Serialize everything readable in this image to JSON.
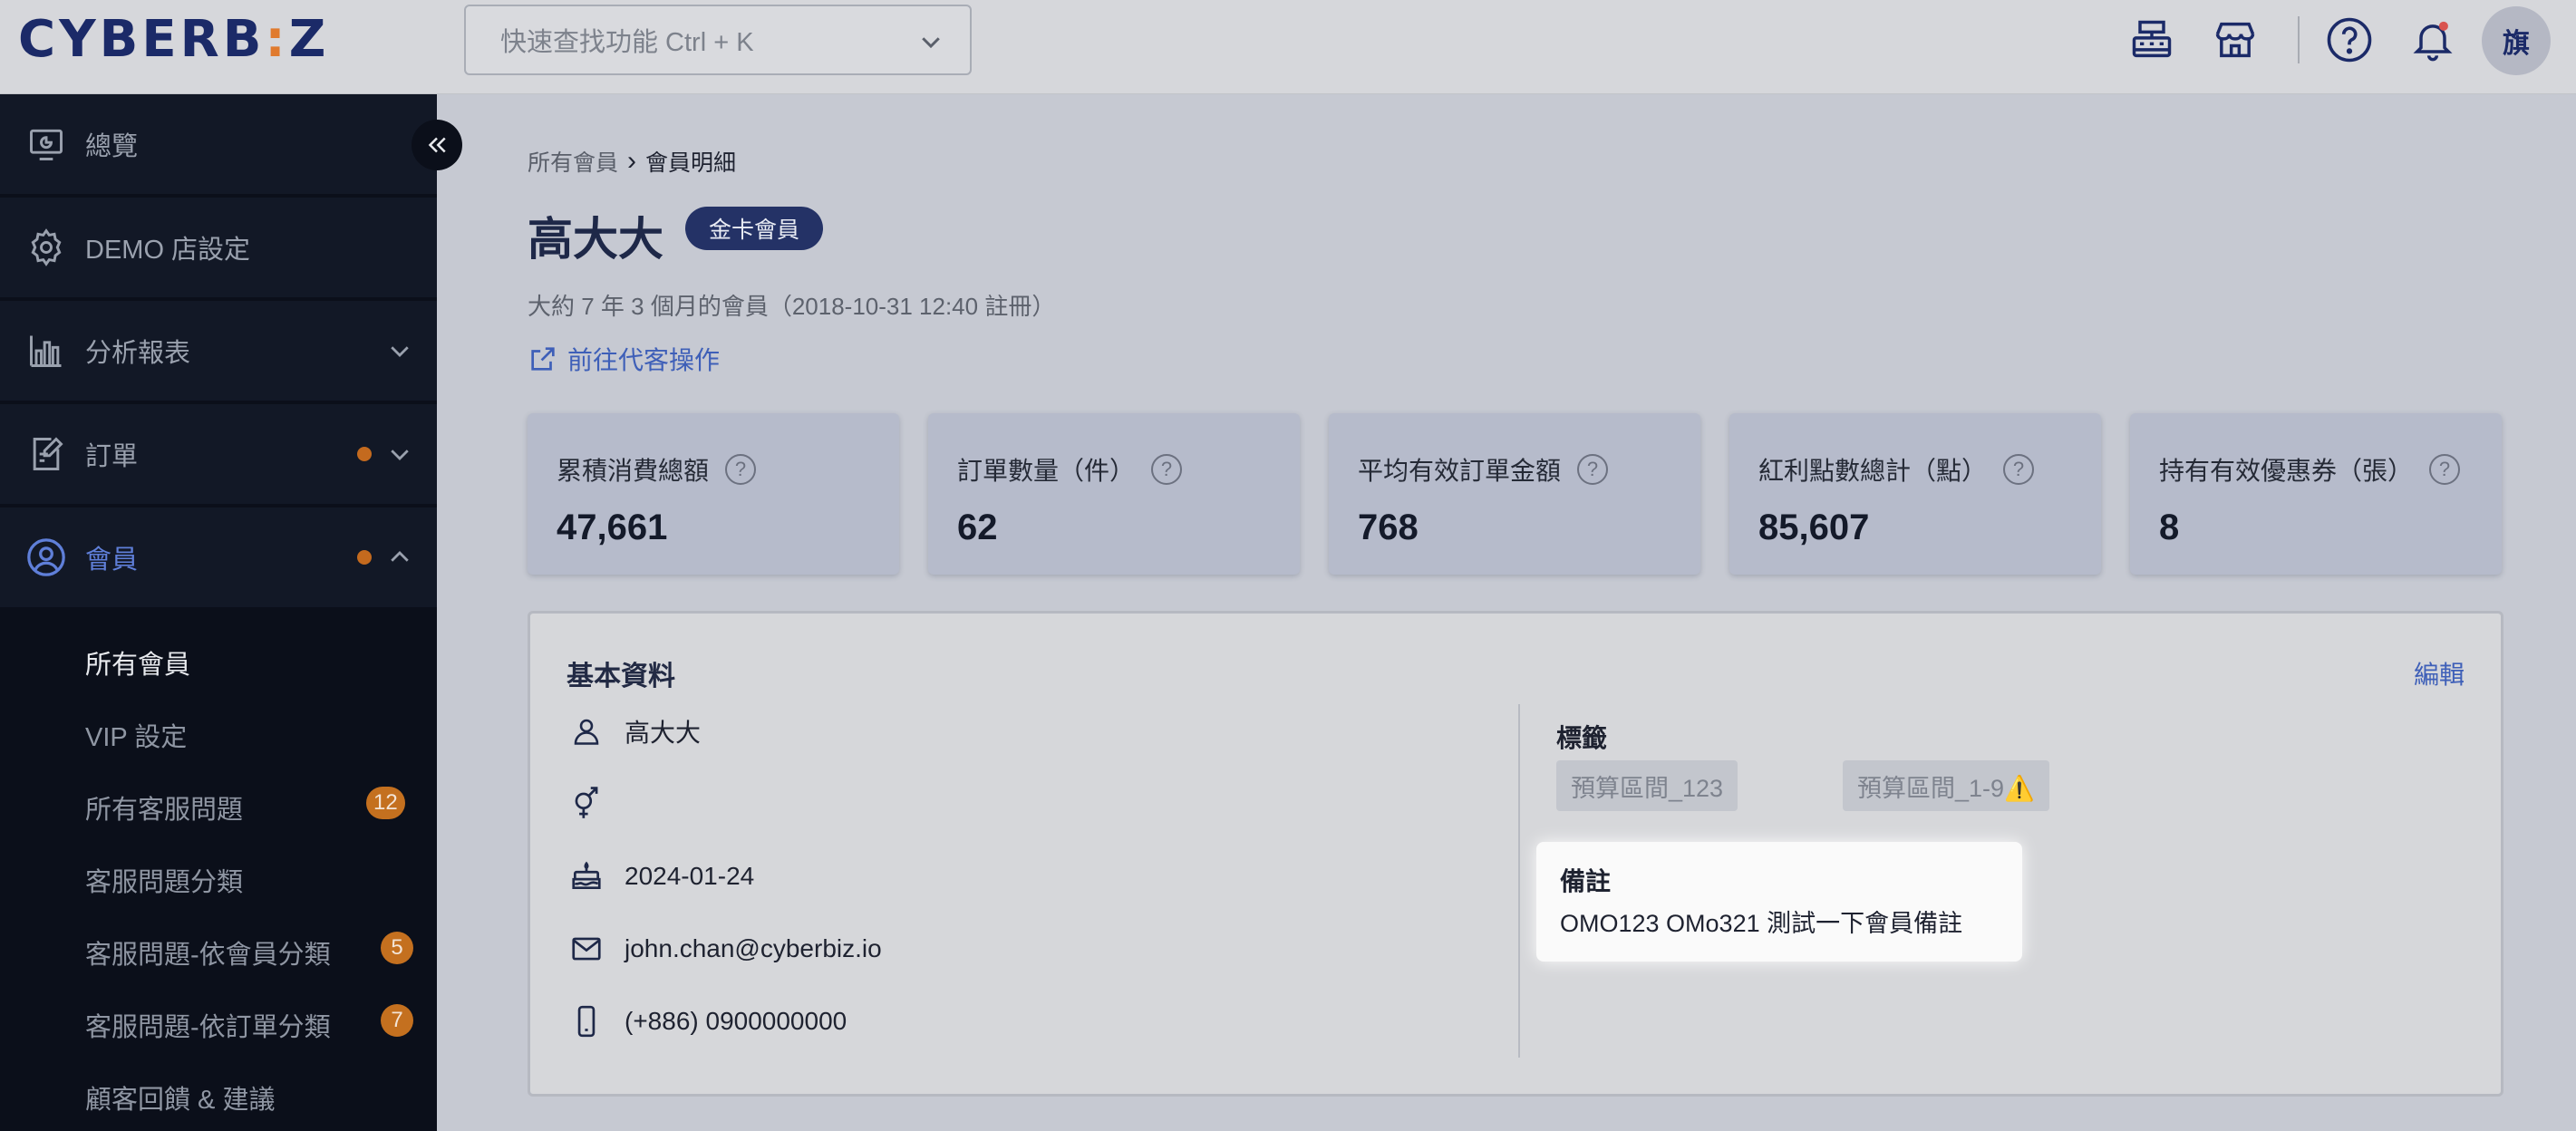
{
  "header": {
    "logo_left": "CYBERB",
    "logo_dot": ":",
    "logo_right": "Z",
    "search_placeholder": "快速查找功能 Ctrl + K",
    "avatar_label": "旗"
  },
  "sidebar": {
    "items": [
      {
        "label": "總覽"
      },
      {
        "label": "DEMO 店設定"
      },
      {
        "label": "分析報表"
      },
      {
        "label": "訂單"
      },
      {
        "label": "會員"
      }
    ],
    "sub_items": [
      {
        "label": "所有會員"
      },
      {
        "label": "VIP 設定"
      },
      {
        "label": "所有客服問題",
        "badge": "12"
      },
      {
        "label": "客服問題分類"
      },
      {
        "label": "客服問題-依會員分類",
        "badge": "5"
      },
      {
        "label": "客服問題-依訂單分類",
        "badge": "7"
      },
      {
        "label": "顧客回饋 & 建議"
      }
    ]
  },
  "main": {
    "breadcrumb": {
      "parent": "所有會員",
      "sep": "›",
      "current": "會員明細"
    },
    "member_name": "高大大",
    "tier_badge": "金卡會員",
    "member_since": "大約 7 年 3 個月的會員（2018-10-31 12:40 註冊）",
    "proxy_link": "前往代客操作",
    "stats": [
      {
        "label": "累積消費總額",
        "value": "47,661"
      },
      {
        "label": "訂單數量（件）",
        "value": "62"
      },
      {
        "label": "平均有效訂單金額",
        "value": "768"
      },
      {
        "label": "紅利點數總計（點）",
        "value": "85,607"
      },
      {
        "label": "持有有效優惠券（張）",
        "value": "8"
      }
    ],
    "basic_info": {
      "title": "基本資料",
      "edit_label": "編輯",
      "name": "高大大",
      "gender": "",
      "birthday": "2024-01-24",
      "email": "john.chan@cyberbiz.io",
      "phone": "(+886) 0900000000",
      "tags_title": "標籤",
      "tags": [
        "預算區間_123",
        "預算區間_1-9⚠️"
      ],
      "note_title": "備註",
      "note_value": "OMO123 OMo321 測試一下會員備註"
    }
  }
}
